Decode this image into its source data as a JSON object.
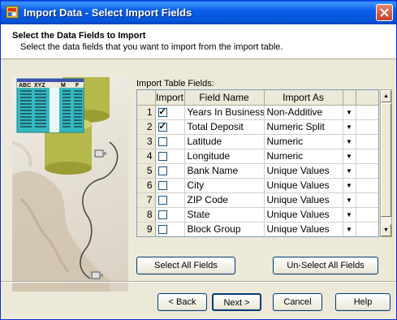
{
  "window": {
    "title": "Import Data - Select Import Fields"
  },
  "header": {
    "title": "Select the Data Fields to Import",
    "subtitle": "Select the data fields that you want to import from the import table."
  },
  "illustration": {
    "table_headers": [
      "ABC",
      "XYZ",
      "M",
      "F"
    ]
  },
  "fields": {
    "label": "Import Table Fields:",
    "columns": {
      "import": "Import",
      "field_name": "Field Name",
      "import_as": "Import As"
    },
    "rows": [
      {
        "num": "1",
        "checked": true,
        "name": "Years In Business",
        "import_as": "Non-Additive"
      },
      {
        "num": "2",
        "checked": true,
        "name": "Total Deposit",
        "import_as": "Numeric Split"
      },
      {
        "num": "3",
        "checked": false,
        "name": "Latitude",
        "import_as": "Numeric"
      },
      {
        "num": "4",
        "checked": false,
        "name": "Longitude",
        "import_as": "Numeric"
      },
      {
        "num": "5",
        "checked": false,
        "name": "Bank Name",
        "import_as": "Unique Values"
      },
      {
        "num": "6",
        "checked": false,
        "name": "City",
        "import_as": "Unique Values"
      },
      {
        "num": "7",
        "checked": false,
        "name": "ZIP Code",
        "import_as": "Unique Values"
      },
      {
        "num": "8",
        "checked": false,
        "name": "State",
        "import_as": "Unique Values"
      },
      {
        "num": "9",
        "checked": false,
        "name": "Block Group",
        "import_as": "Unique Values"
      }
    ]
  },
  "buttons": {
    "select_all": "Select All Fields",
    "unselect_all": "Un-Select All Fields",
    "back": "< Back",
    "next": "Next >",
    "cancel": "Cancel",
    "help": "Help"
  },
  "icons": {
    "app": "app-icon",
    "close": "close-icon",
    "dropdown": "dropdown-arrow-icon",
    "scroll_up": "scroll-up-icon",
    "scroll_down": "scroll-down-icon"
  },
  "colors": {
    "titlebar": "#0a5fe8",
    "close": "#c4402a",
    "dialog": "#ece9d8",
    "teal": "#36b8c2",
    "olive": "#b5b84a"
  }
}
